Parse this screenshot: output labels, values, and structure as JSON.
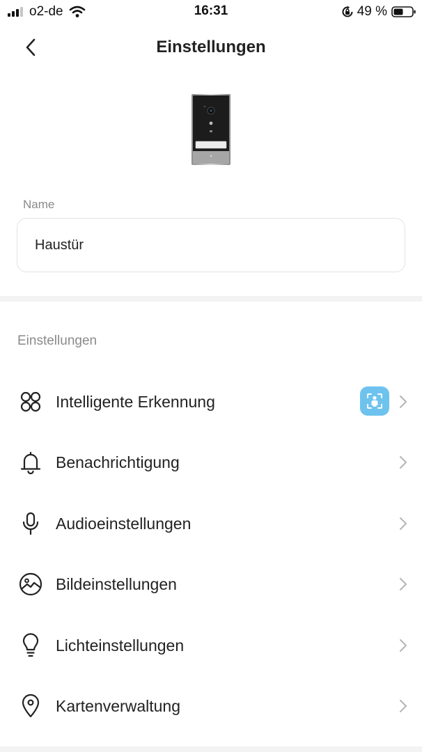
{
  "status_bar": {
    "carrier": "o2-de",
    "time": "16:31",
    "battery": "49 %"
  },
  "nav": {
    "title": "Einstellungen"
  },
  "device": {
    "name_label": "Name",
    "name_value": "Haustür"
  },
  "settings": {
    "section_title": "Einstellungen",
    "items": [
      {
        "label": "Intelligente Erkennung",
        "icon": "four-circles-icon"
      },
      {
        "label": "Benachrichtigung",
        "icon": "bell-icon"
      },
      {
        "label": "Audioeinstellungen",
        "icon": "microphone-icon"
      },
      {
        "label": "Bildeinstellungen",
        "icon": "image-icon"
      },
      {
        "label": "Lichteinstellungen",
        "icon": "lightbulb-icon"
      },
      {
        "label": "Kartenverwaltung",
        "icon": "location-pin-icon"
      }
    ]
  },
  "colors": {
    "badge_blue": "#6ec3ee",
    "divider": "#f3f3f3",
    "muted_text": "#8a8a8a"
  }
}
